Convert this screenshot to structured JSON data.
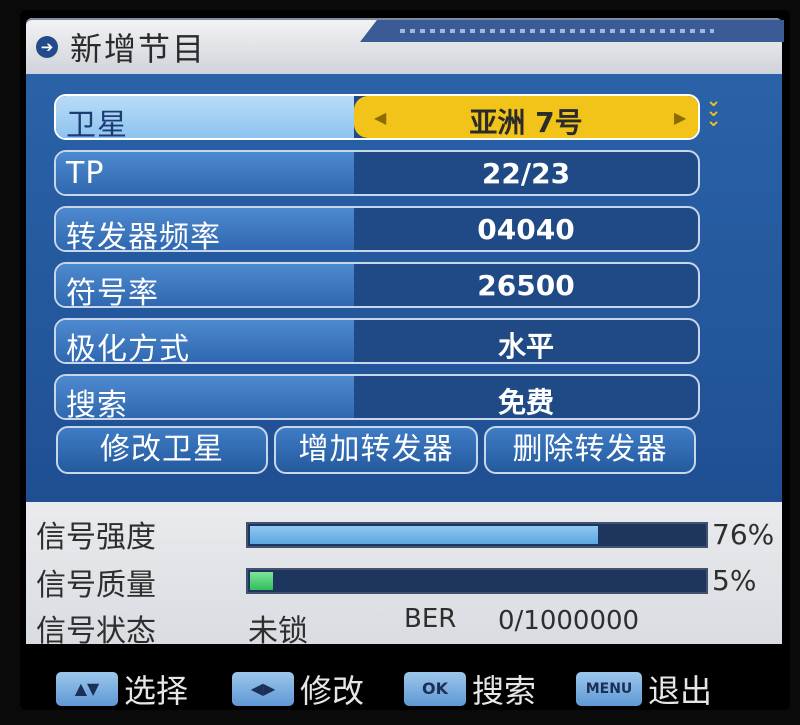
{
  "title": "新增节目",
  "rows": [
    {
      "label": "卫星",
      "value": "亚洲 7号"
    },
    {
      "label": "TP",
      "value": "22/23"
    },
    {
      "label": "转发器频率",
      "value": "04040"
    },
    {
      "label": "符号率",
      "value": "26500"
    },
    {
      "label": "极化方式",
      "value": "水平"
    },
    {
      "label": "搜索",
      "value": "免费"
    }
  ],
  "buttons": {
    "modify_satellite": "修改卫星",
    "add_transponder": "增加转发器",
    "delete_transponder": "删除转发器"
  },
  "signal": {
    "strength_label": "信号强度",
    "strength_pct": "76%",
    "strength_value": 0.76,
    "quality_label": "信号质量",
    "quality_pct": "5%",
    "quality_value": 0.05,
    "status_label": "信号状态",
    "status_value": "未锁",
    "ber_label": "BER",
    "ber_value": "0/1000000"
  },
  "footer": {
    "select_key": "▲▼",
    "select_label": "选择",
    "modify_key": "◀▶",
    "modify_label": "修改",
    "ok_key": "OK",
    "search_label": "搜索",
    "menu_key": "MENU",
    "exit_label": "退出"
  },
  "colors": {
    "highlight": "#f2c41a",
    "panel": "#2a62a8",
    "strength_bar": "#8fc7f2",
    "quality_bar": "#2fbf5a"
  }
}
